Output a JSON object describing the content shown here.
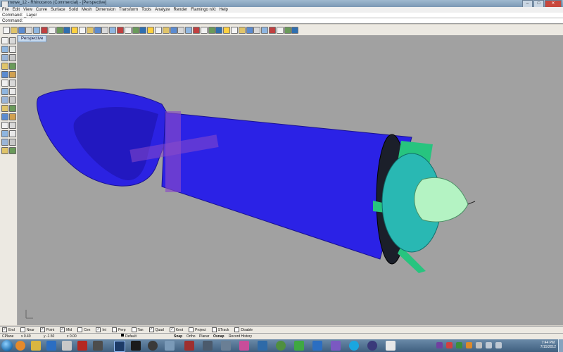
{
  "window": {
    "title": "mowe_12 - Rhinoceros (Commercial) - [Perspective]",
    "buttons": [
      "–",
      "□",
      "✕"
    ]
  },
  "menu": [
    "File",
    "Edit",
    "View",
    "Curve",
    "Surface",
    "Solid",
    "Mesh",
    "Dimension",
    "Transform",
    "Tools",
    "Analyze",
    "Render",
    "Flamingo nXt",
    "Help"
  ],
  "command_history": "Command: _Layer",
  "command_prompt": "Command:",
  "viewport": {
    "tab_label": "Perspective",
    "background_color": "#a1a1a1"
  },
  "toolbar_icons": [
    "new-icon",
    "open-icon",
    "save-icon",
    "print-icon",
    "import-icon",
    "cut-icon",
    "copy-icon",
    "paste-icon",
    "undo-icon",
    "redo-icon",
    "pan-icon",
    "rotate-view-icon",
    "zoom-icon",
    "zoom-window-icon",
    "zoom-extents-icon",
    "zoom-selected-icon",
    "undo-view-icon",
    "set-view-icon",
    "cplane-icon",
    "four-views-icon",
    "select-all-icon",
    "lock-icon",
    "hide-icon",
    "layer-icon",
    "properties-icon",
    "wireframe-icon",
    "shaded-icon",
    "rendered-icon",
    "render-icon",
    "material-icon",
    "environment-icon",
    "light-icon",
    "grid-icon",
    "osnap-icon",
    "curve-edit-icon",
    "points-on-icon",
    "analyze-icon",
    "options-icon",
    "help-icon"
  ],
  "osnap": [
    {
      "label": "End",
      "checked": true
    },
    {
      "label": "Near",
      "checked": false
    },
    {
      "label": "Point",
      "checked": true
    },
    {
      "label": "Mid",
      "checked": true
    },
    {
      "label": "Cen",
      "checked": false
    },
    {
      "label": "Int",
      "checked": true
    },
    {
      "label": "Perp",
      "checked": false
    },
    {
      "label": "Tan",
      "checked": false
    },
    {
      "label": "Quad",
      "checked": true
    },
    {
      "label": "Knot",
      "checked": true
    },
    {
      "label": "Project",
      "checked": false
    },
    {
      "label": "STrack",
      "checked": false
    },
    {
      "label": "Disable",
      "checked": false
    }
  ],
  "status": {
    "cplane": "CPlane",
    "x": "x 0.49",
    "y": "y -1.50",
    "z": "z 0.00",
    "layer": "Default",
    "snap": "Snap",
    "ortho": "Ortho",
    "planar": "Planar",
    "osnap": "Osnap",
    "record_history": "Record History"
  },
  "clock": {
    "time": "7:44 PM",
    "date": "7/15/2012"
  },
  "colors": {
    "body": "#2b21e6",
    "nose": "#2d24e0",
    "fan": "#29b8b3",
    "spinner": "#b4f3c3",
    "fins": "#27c47f",
    "cross": "#8a4bc8"
  }
}
